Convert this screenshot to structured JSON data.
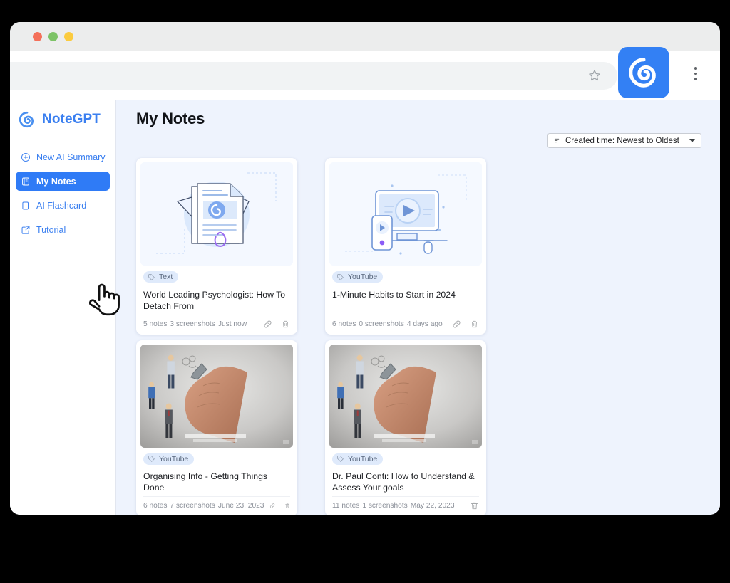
{
  "browser": {
    "traffic_lights": [
      "close",
      "minimize",
      "maximize"
    ],
    "address_value": "",
    "address_placeholder": "",
    "bookmark_icon": "star-icon",
    "extension_icon": "notegpt-spiral-logo",
    "menu_icon": "kebab-menu-icon"
  },
  "sidebar": {
    "brand": "NoteGPT",
    "items": [
      {
        "label": "New AI Summary",
        "icon": "plus-circle-icon",
        "active": false
      },
      {
        "label": "My Notes",
        "icon": "notebook-icon",
        "active": true
      },
      {
        "label": "AI Flashcard",
        "icon": "flashcard-icon",
        "active": false
      },
      {
        "label": "Tutorial",
        "icon": "external-link-icon",
        "active": false
      }
    ]
  },
  "main": {
    "title": "My Notes",
    "sort": {
      "icon": "sort-icon",
      "value": "Created time: Newest to Oldest",
      "caret": "chevron-down-icon"
    },
    "cards": [
      {
        "thumb": "document-illustration",
        "tag": "Text",
        "title": "World Leading Psychologist: How To Detach From",
        "notes": "5 notes",
        "screenshots": "3 screenshots",
        "date": "Just now",
        "actions": [
          "link-icon",
          "trash-icon"
        ]
      },
      {
        "thumb": "video-illustration",
        "tag": "YouTube",
        "title": "1-Minute Habits to Start in 2024",
        "notes": "6 notes",
        "screenshots": "0 screenshots",
        "date": "4 days ago",
        "actions": [
          "link-icon",
          "trash-icon"
        ]
      },
      {
        "thumb": "whiteboard-photo",
        "tag": "YouTube",
        "title": "Organising Info - Getting Things Done",
        "notes": "6 notes",
        "screenshots": "7 screenshots",
        "date": "June 23, 2023",
        "actions": [
          "link-icon",
          "trash-icon"
        ]
      },
      {
        "thumb": "whiteboard-photo",
        "tag": "YouTube",
        "title": "Dr. Paul Conti: How to Understand & Assess Your goals",
        "notes": "11 notes",
        "screenshots": "1 screenshots",
        "date": "May 22, 2023",
        "actions": [
          "trash-icon"
        ]
      }
    ]
  },
  "colors": {
    "accent": "#2f7bf6",
    "brand_text": "#3a7ff0",
    "app_background": "#eef3fd",
    "card": "#ffffff",
    "tag_background": "#dfeafb"
  },
  "cursor": {
    "icon": "pointing-hand-cursor"
  }
}
